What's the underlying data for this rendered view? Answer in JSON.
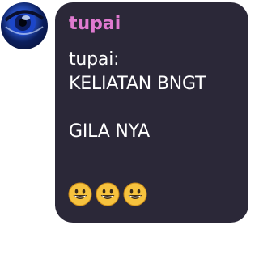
{
  "message": {
    "sender": "tupai",
    "lines": [
      "tupai:",
      "KELIATAN BNGT",
      "",
      "GILA NYA"
    ],
    "emoji_icons": [
      "grinning-face-icon",
      "grinning-face-icon",
      "grinning-face-icon"
    ]
  },
  "colors": {
    "bubble": "#2b2838",
    "sender": "#e07ad0",
    "text": "#ffffff",
    "emoji": "#f6c23e"
  }
}
